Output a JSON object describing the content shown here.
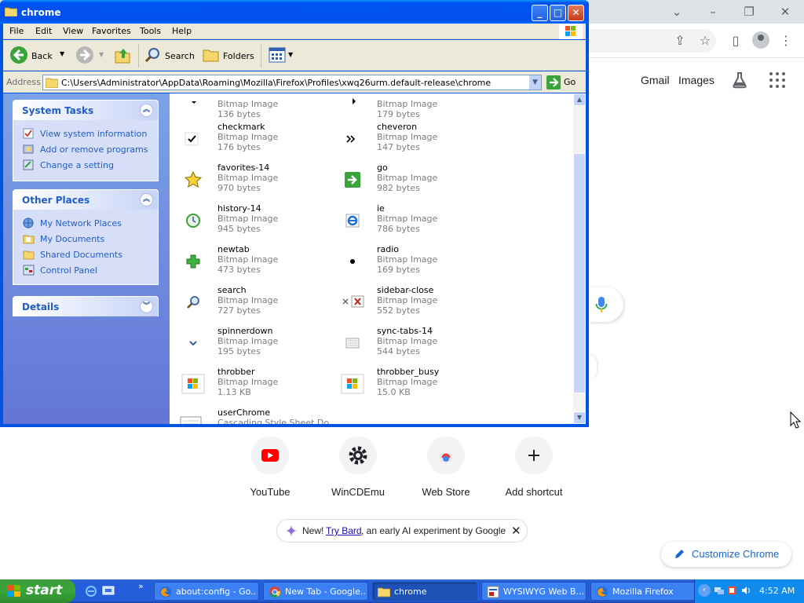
{
  "chrome": {
    "header_links": {
      "gmail": "Gmail",
      "images": "Images"
    },
    "shortcuts": [
      {
        "label": "YouTube",
        "icon": "youtube-icon"
      },
      {
        "label": "WinCDEmu",
        "icon": "gear-icon"
      },
      {
        "label": "Web Store",
        "icon": "chrome-web-store-icon"
      },
      {
        "label": "Add shortcut",
        "icon": "plus-icon"
      }
    ],
    "bard_banner": {
      "new": "New!",
      "link": "Try Bard",
      "rest": ", an early AI experiment by Google"
    },
    "customize_label": "Customize Chrome"
  },
  "explorer": {
    "title": "chrome",
    "menu": [
      "File",
      "Edit",
      "View",
      "Favorites",
      "Tools",
      "Help"
    ],
    "toolbar": {
      "back": "Back",
      "search": "Search",
      "folders": "Folders"
    },
    "address": {
      "label": "Address",
      "path": "C:\\Users\\Administrator\\AppData\\Roaming\\Mozilla\\Firefox\\Profiles\\xwq26urm.default-release\\chrome",
      "go": "Go"
    },
    "system_tasks": {
      "title": "System Tasks",
      "items": [
        "View system information",
        "Add or remove programs",
        "Change a setting"
      ]
    },
    "other_places": {
      "title": "Other Places",
      "items": [
        "My Network Places",
        "My Documents",
        "Shared Documents",
        "Control Panel"
      ]
    },
    "details": {
      "title": "Details"
    },
    "files": [
      {
        "name": "",
        "type": "Bitmap Image",
        "size": "136 bytes"
      },
      {
        "name": "",
        "type": "Bitmap Image",
        "size": "179 bytes"
      },
      {
        "name": "checkmark",
        "type": "Bitmap Image",
        "size": "176 bytes"
      },
      {
        "name": "cheveron",
        "type": "Bitmap Image",
        "size": "147 bytes"
      },
      {
        "name": "favorites-14",
        "type": "Bitmap Image",
        "size": "970 bytes"
      },
      {
        "name": "go",
        "type": "Bitmap Image",
        "size": "982 bytes"
      },
      {
        "name": "history-14",
        "type": "Bitmap Image",
        "size": "945 bytes"
      },
      {
        "name": "ie",
        "type": "Bitmap Image",
        "size": "786 bytes"
      },
      {
        "name": "newtab",
        "type": "Bitmap Image",
        "size": "473 bytes"
      },
      {
        "name": "radio",
        "type": "Bitmap Image",
        "size": "169 bytes"
      },
      {
        "name": "search",
        "type": "Bitmap Image",
        "size": "727 bytes"
      },
      {
        "name": "sidebar-close",
        "type": "Bitmap Image",
        "size": "552 bytes"
      },
      {
        "name": "spinnerdown",
        "type": "Bitmap Image",
        "size": "195 bytes"
      },
      {
        "name": "sync-tabs-14",
        "type": "Bitmap Image",
        "size": "544 bytes"
      },
      {
        "name": "throbber",
        "type": "Bitmap Image",
        "size": "1.13 KB"
      },
      {
        "name": "throbber_busy",
        "type": "Bitmap Image",
        "size": "15.0 KB"
      },
      {
        "name": "userChrome",
        "type": "Cascading Style Sheet Do",
        "size": ""
      }
    ]
  },
  "taskbar": {
    "start": "start",
    "tasks": [
      {
        "label": "about:config - Go...",
        "icon": "firefox-icon"
      },
      {
        "label": "New Tab - Google...",
        "icon": "chrome-icon"
      },
      {
        "label": "chrome",
        "icon": "folder-icon"
      },
      {
        "label": "WYSIWYG Web B...",
        "icon": "editor-icon"
      },
      {
        "label": "Mozilla Firefox",
        "icon": "firefox-icon"
      }
    ],
    "clock": "4:52 AM"
  }
}
